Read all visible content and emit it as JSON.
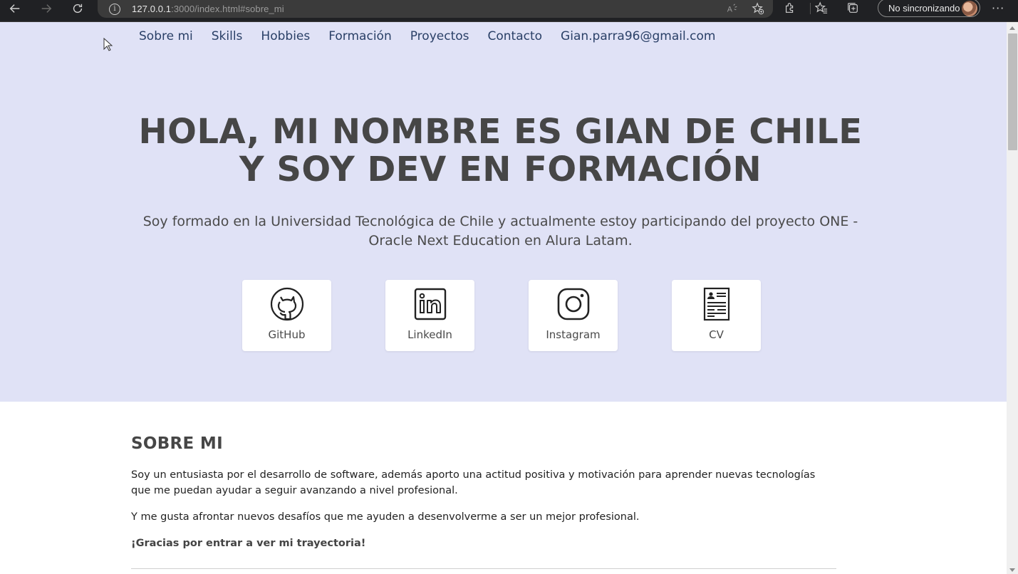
{
  "browser": {
    "url_host": "127.0.0.1",
    "url_rest": ":3000/index.html#sobre_mi",
    "profile_label": "No sincronizando",
    "more_label": "···"
  },
  "nav": {
    "items": [
      {
        "label": "Sobre mi"
      },
      {
        "label": "Skills"
      },
      {
        "label": "Hobbies"
      },
      {
        "label": "Formación"
      },
      {
        "label": "Proyectos"
      },
      {
        "label": "Contacto"
      },
      {
        "label": "Gian.parra96@gmail.com"
      }
    ]
  },
  "hero": {
    "title_line1": "HOLA, MI NOMBRE ES GIAN DE CHILE",
    "title_line2": "Y SOY DEV EN FORMACIÓN",
    "subtitle": "Soy formado en la Universidad Tecnológica de Chile y actualmente estoy participando del proyecto ONE - Oracle Next Education en Alura Latam.",
    "cards": [
      {
        "label": "GitHub",
        "icon": "github-icon"
      },
      {
        "label": "LinkedIn",
        "icon": "linkedin-icon"
      },
      {
        "label": "Instagram",
        "icon": "instagram-icon"
      },
      {
        "label": "CV",
        "icon": "cv-document-icon"
      }
    ]
  },
  "about": {
    "heading": "SOBRE MI",
    "p1": "Soy un entusiasta por el desarrollo de software, además aporto una actitud positiva y motivación para aprender nuevas tecnologías que me puedan ayudar a seguir avanzando a nivel profesional.",
    "p2": "Y me gusta afrontar nuevos desafíos que me ayuden a desenvolverme a ser un mejor profesional.",
    "p3": "¡Gracias por entrar a ver mi trayectoria!"
  },
  "colors": {
    "hero_bg": "#e0e2f6",
    "nav_link": "#2a4067",
    "heading": "#464646"
  }
}
